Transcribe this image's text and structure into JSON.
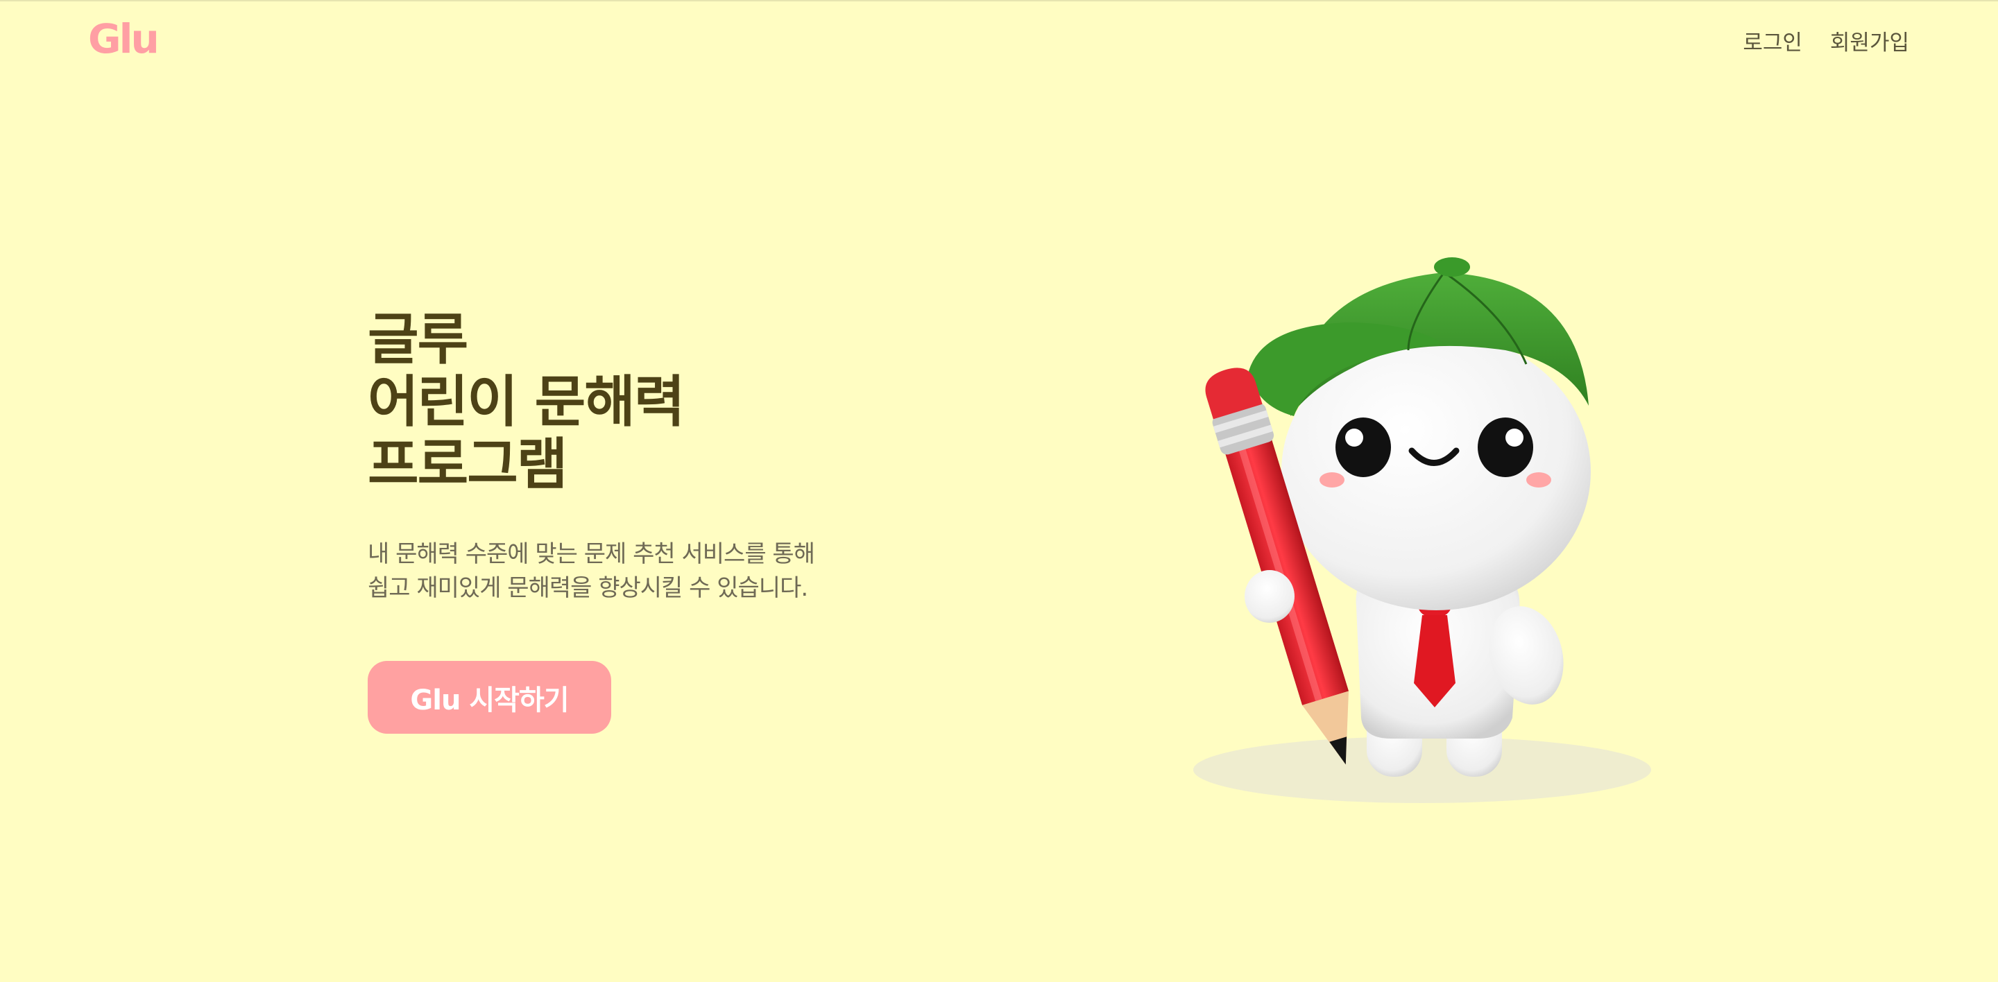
{
  "header": {
    "logo": "Glu",
    "nav": {
      "login": "로그인",
      "signup": "회원가입"
    }
  },
  "hero": {
    "title_lines": [
      "글루",
      "어린이 문해력",
      "프로그램"
    ],
    "description_lines": [
      "내 문해력 수준에 맞는 문제 추천 서비스를 통해",
      "쉽고 재미있게 문해력을 향상시킬 수 있습니다."
    ],
    "cta_label": "Glu 시작하기"
  },
  "colors": {
    "background": "#fffdc2",
    "brand_pink": "#ffa1a1",
    "title": "#4d4216",
    "body_text": "#6f6a55"
  },
  "icons": {
    "mascot": "mascot-illustration"
  }
}
